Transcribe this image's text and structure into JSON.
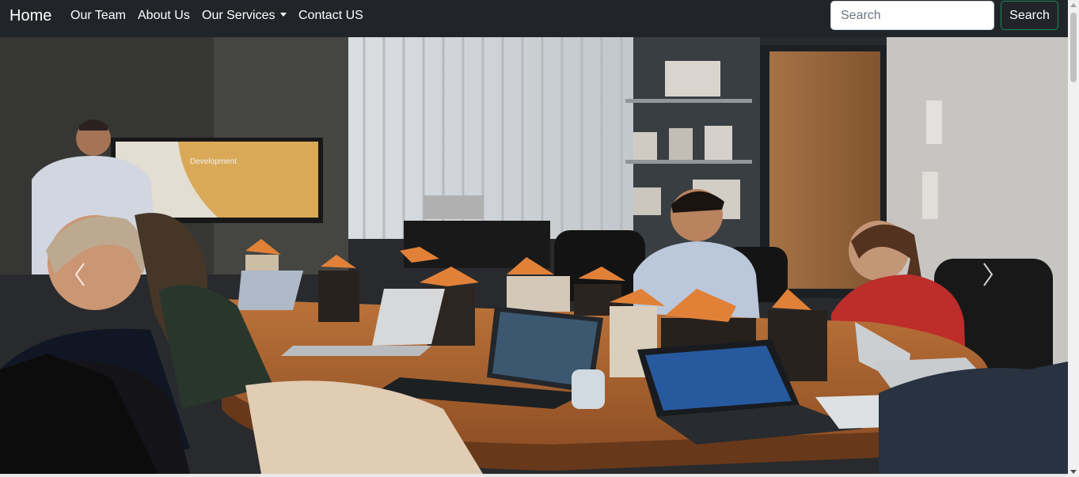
{
  "navbar": {
    "brand": "Home",
    "links": [
      "Our Team",
      "About Us",
      "Our Services",
      "Contact US"
    ],
    "search_placeholder": "Search",
    "search_button": "Search"
  },
  "carousel": {
    "image_alt": "Team meeting in a conference room with laptops",
    "prev_icon": "chevron-left-icon",
    "next_icon": "chevron-right-icon"
  }
}
